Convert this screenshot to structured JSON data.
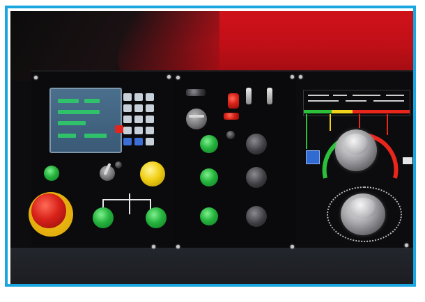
{
  "image": {
    "subject": "machine-control-panel-photo",
    "frame_color": "#1aa6e0",
    "hood_color": "#c10f17",
    "panel_color": "#0b0b0d"
  },
  "icons": {
    "emergency_stop": "emergency-stop-icon",
    "pushbutton": "pushbutton-icon",
    "selector_switch": "selector-switch-icon",
    "toggle_switch": "toggle-switch-icon",
    "rotary_knob": "rotary-knob-icon",
    "keypad": "keypad-icon",
    "display": "display-icon"
  }
}
